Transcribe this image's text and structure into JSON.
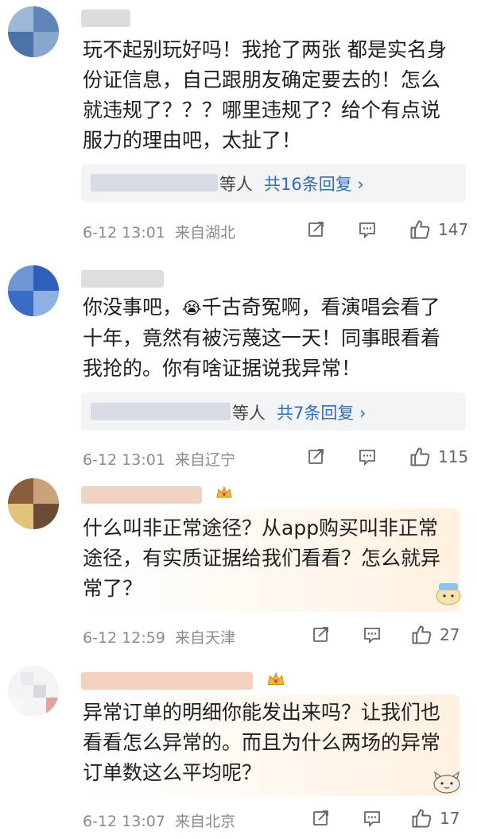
{
  "comments": [
    {
      "text": "玩不起别玩好吗！我抢了两张 都是实名身份证信息，自己跟朋友确定要去的！怎么就违规了？？？哪里违规了？给个有点说服力的理由吧，太扯了！",
      "reply_suffix": "等人",
      "reply_count": "共16条回复 ›",
      "time": "6-12 13:01",
      "location": "来自湖北",
      "likes": "147"
    },
    {
      "text_before_emoji": "你没事吧，",
      "emoji": "😭",
      "text_after_emoji": "千古奇冤啊，看演唱会看了十年，竟然有被污蔑这一天！同事眼看着我抢的。你有啥证据说我异常！",
      "reply_suffix": "等人",
      "reply_count": "共7条回复 ›",
      "time": "6-12 13:01",
      "location": "来自辽宁",
      "likes": "115"
    },
    {
      "text": "什么叫非正常途径？从app购买叫非正常途径，有实质证据给我们看看？怎么就异常了？",
      "time": "6-12 12:59",
      "location": "来自天津",
      "likes": "27",
      "badge_icon": "crown-badge-icon"
    },
    {
      "text": "异常订单的明细你能发出来吗？让我们也看看怎么异常的。而且为什么两场的异常订单数这么平均呢？",
      "time": "6-12 13:07",
      "location": "来自北京",
      "likes": "17",
      "badge_icon": "crown-badge-icon"
    }
  ],
  "icons": {
    "share": "share-icon",
    "comment": "comment-icon",
    "like": "thumbs-up-icon"
  },
  "colors": {
    "link": "#2f6db5",
    "meta": "#8a8a8a",
    "reply_bg": "#f3f4f6"
  }
}
